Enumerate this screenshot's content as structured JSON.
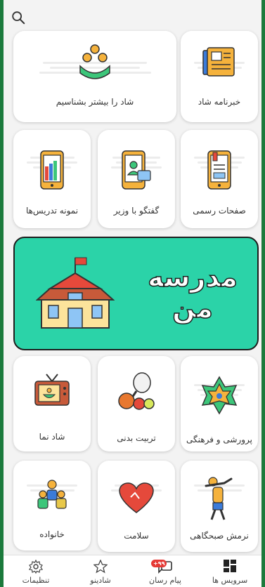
{
  "search": {
    "icon": "search-icon"
  },
  "cards": {
    "about": "شاد را بیشتر بشناسیم",
    "news": "خبرنامه شاد",
    "samples": "نمونه تدریس‌ها",
    "minister": "گفتگو با وزیر",
    "official": "صفحات رسمی",
    "shadnama": "شاد نما",
    "sport": "تربیت بدنی",
    "culture": "پرورشی و فرهنگی",
    "family": "خانواده",
    "health": "سلامت",
    "exercise": "نرمش صبحگاهی"
  },
  "banner": {
    "title_line1": "مدرسه",
    "title_line2": "من"
  },
  "bottom_nav": {
    "services": "سرویس ها",
    "messenger": "پیام رسان",
    "messenger_badge": "+۹۹",
    "shadino": "شادینو",
    "settings": "تنظیمات"
  },
  "colors": {
    "frame": "#1b7a3c",
    "banner": "#2bd3a8"
  }
}
